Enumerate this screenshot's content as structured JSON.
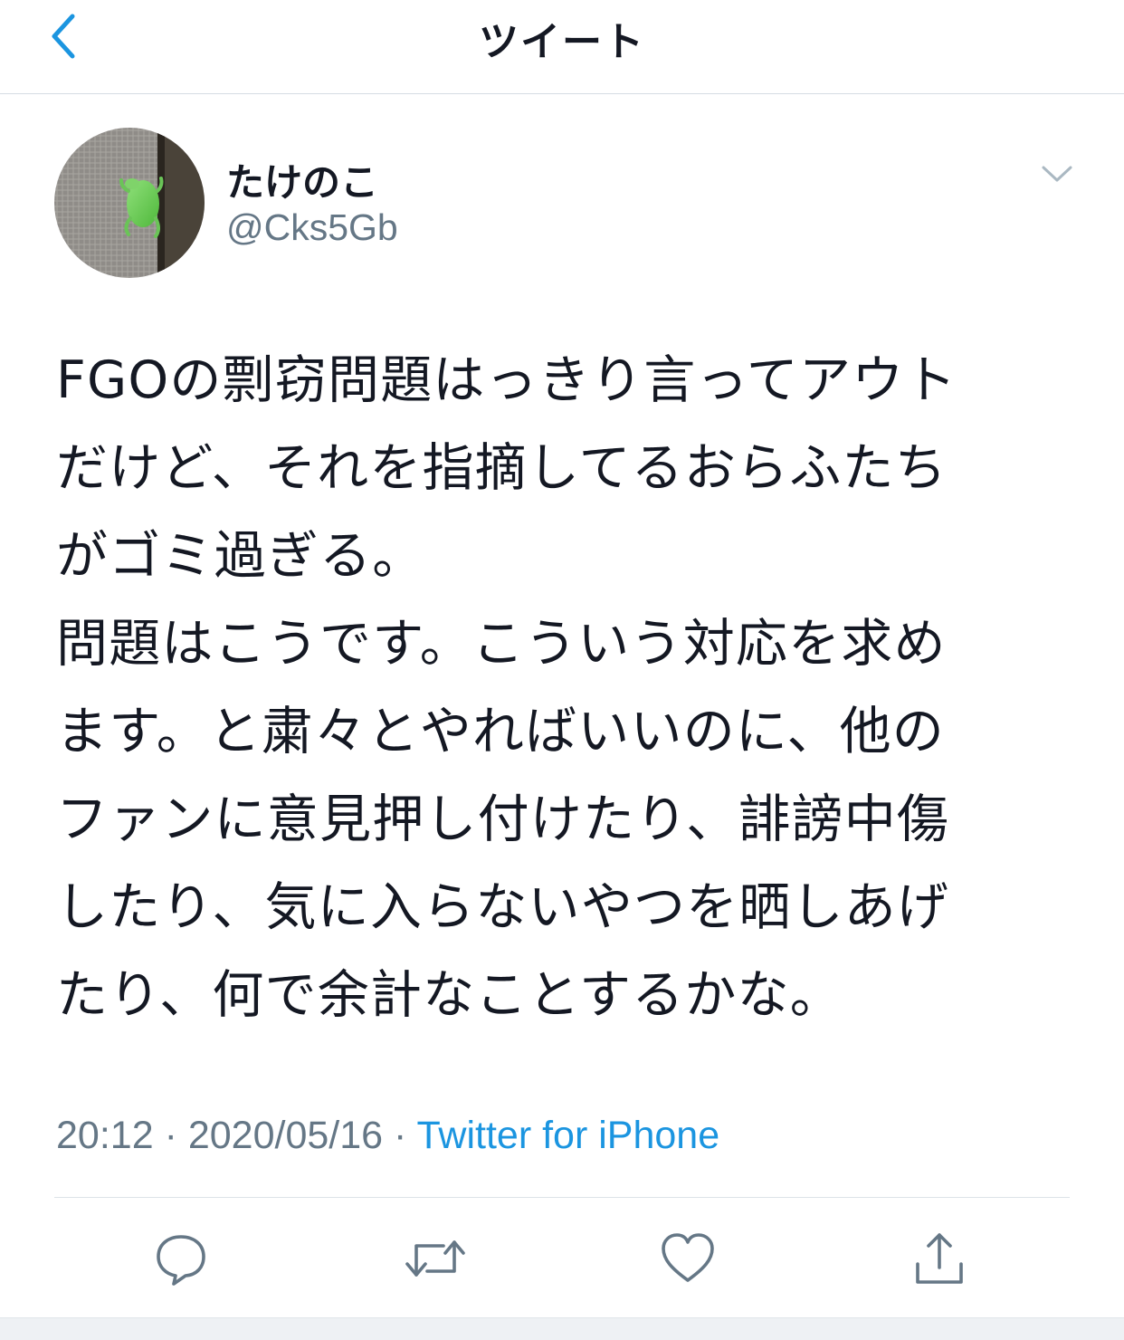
{
  "nav": {
    "title": "ツイート"
  },
  "user": {
    "display_name": "たけのこ",
    "handle": "@Cks5Gb"
  },
  "tweet": {
    "lines": [
      "FGOの剽窃問題はっきり言ってアウト",
      "だけど、それを指摘してるおらふたち",
      "がゴミ過ぎる。",
      "問題はこうです。こういう対応を求め",
      "ます。と粛々とやればいいのに、他の",
      "ファンに意見押し付けたり、誹謗中傷",
      "したり、気に入らないやつを晒しあげ",
      "たり、何で余計なことするかな。"
    ],
    "time": "20:12",
    "date": "2020/05/16",
    "separator": "·",
    "source": "Twitter for iPhone"
  },
  "colors": {
    "accent": "#1b95e0",
    "text": "#141823",
    "secondary": "#657786"
  },
  "icons": {
    "back": "chevron-left-icon",
    "more": "chevron-down-icon",
    "reply": "reply-icon",
    "retweet": "retweet-icon",
    "like": "heart-icon",
    "share": "share-icon"
  }
}
